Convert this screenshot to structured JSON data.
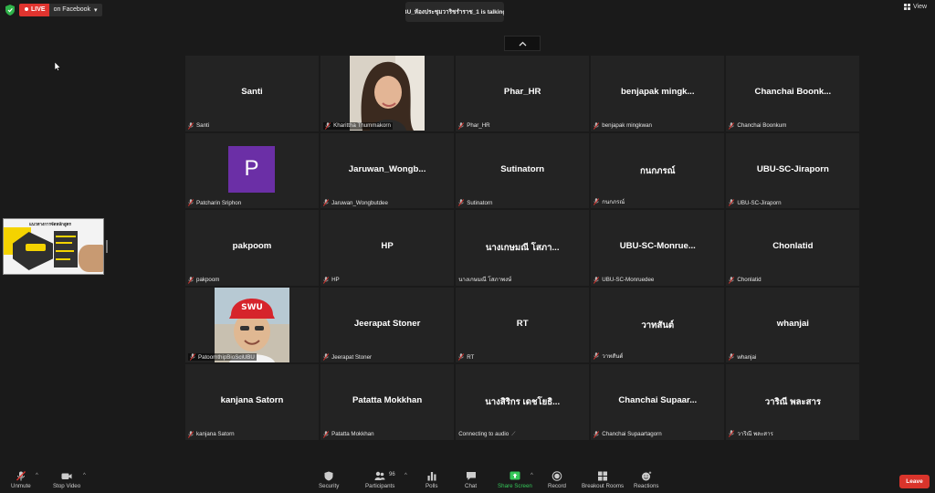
{
  "top": {
    "live_label": "LIVE",
    "facebook_label": "on Facebook",
    "talking": "UBU_ห้องประชุมวาริชรำราช_1 is talking...",
    "view_label": "View"
  },
  "share": {
    "title": "แนวทางการจัดหลักสูตร"
  },
  "participants": [
    {
      "name": "Santi",
      "footer": "Santi",
      "kind": "name"
    },
    {
      "name": "",
      "footer": "Kharittha Thummakorn",
      "kind": "photo-woman"
    },
    {
      "name": "Phar_HR",
      "footer": "Phar_HR",
      "kind": "name"
    },
    {
      "name": "benjapak mingk...",
      "footer": "benjapak mingkwan",
      "kind": "name"
    },
    {
      "name": "Chanchai Boonk...",
      "footer": "Chanchai Boonkum",
      "kind": "name"
    },
    {
      "name": "P",
      "footer": "Patcharin Sriphon",
      "kind": "avatar"
    },
    {
      "name": "Jaruwan_Wongb...",
      "footer": "Jaruwan_Wongbutdee",
      "kind": "name"
    },
    {
      "name": "Sutinatorn",
      "footer": "Sutinatorn",
      "kind": "name"
    },
    {
      "name": "กนกภรณ์",
      "footer": "กนกภรณ์",
      "kind": "name"
    },
    {
      "name": "UBU-SC-Jiraporn",
      "footer": "UBU-SC-Jiraporn",
      "kind": "name"
    },
    {
      "name": "pakpoom",
      "footer": "pakpoom",
      "kind": "name"
    },
    {
      "name": "HP",
      "footer": "HP",
      "kind": "name"
    },
    {
      "name": "นางเกษมณี โสภา...",
      "footer": "นางเกษมณี โสภาพงษ์",
      "kind": "name",
      "nomic": true
    },
    {
      "name": "UBU-SC-Monrue...",
      "footer": "UBU-SC-Monruedee",
      "kind": "name"
    },
    {
      "name": "Chonlatid",
      "footer": "Chonlatid",
      "kind": "name"
    },
    {
      "name": "",
      "footer": "PatoomthipBioSciUBU",
      "kind": "photo-man"
    },
    {
      "name": "Jeerapat Stoner",
      "footer": "Jeerapat Stoner",
      "kind": "name"
    },
    {
      "name": "RT",
      "footer": "RT",
      "kind": "name"
    },
    {
      "name": "วาทสันต์",
      "footer": "วาทสันต์",
      "kind": "name"
    },
    {
      "name": "whanjai",
      "footer": "whanjai",
      "kind": "name"
    },
    {
      "name": "kanjana Satorn",
      "footer": "kanjana Satorn",
      "kind": "name"
    },
    {
      "name": "Patatta Mokkhan",
      "footer": "Patatta Mokkhan",
      "kind": "name"
    },
    {
      "name": "นางสิริกร เดชโยธิ...",
      "footer": "Connecting to audio",
      "kind": "name",
      "connecting": true
    },
    {
      "name": "Chanchai Supaar...",
      "footer": "Chanchai Supaartagorn",
      "kind": "name"
    },
    {
      "name": "วาริณี พละสาร",
      "footer": "วาริณี พละสาร",
      "kind": "name"
    }
  ],
  "toolbar": {
    "unmute": "Unmute",
    "stop_video": "Stop Video",
    "security": "Security",
    "participants": "Participants",
    "participant_count": "96",
    "polls": "Polls",
    "chat": "Chat",
    "share_screen": "Share Screen",
    "record": "Record",
    "breakout_rooms": "Breakout Rooms",
    "reactions": "Reactions",
    "leave": "Leave"
  },
  "colors": {
    "live_red": "#e0342f",
    "share_green": "#35c759",
    "leave_red": "#d9342b",
    "avatar_purple": "#6b2fa6",
    "muted_red": "#e0342f"
  }
}
